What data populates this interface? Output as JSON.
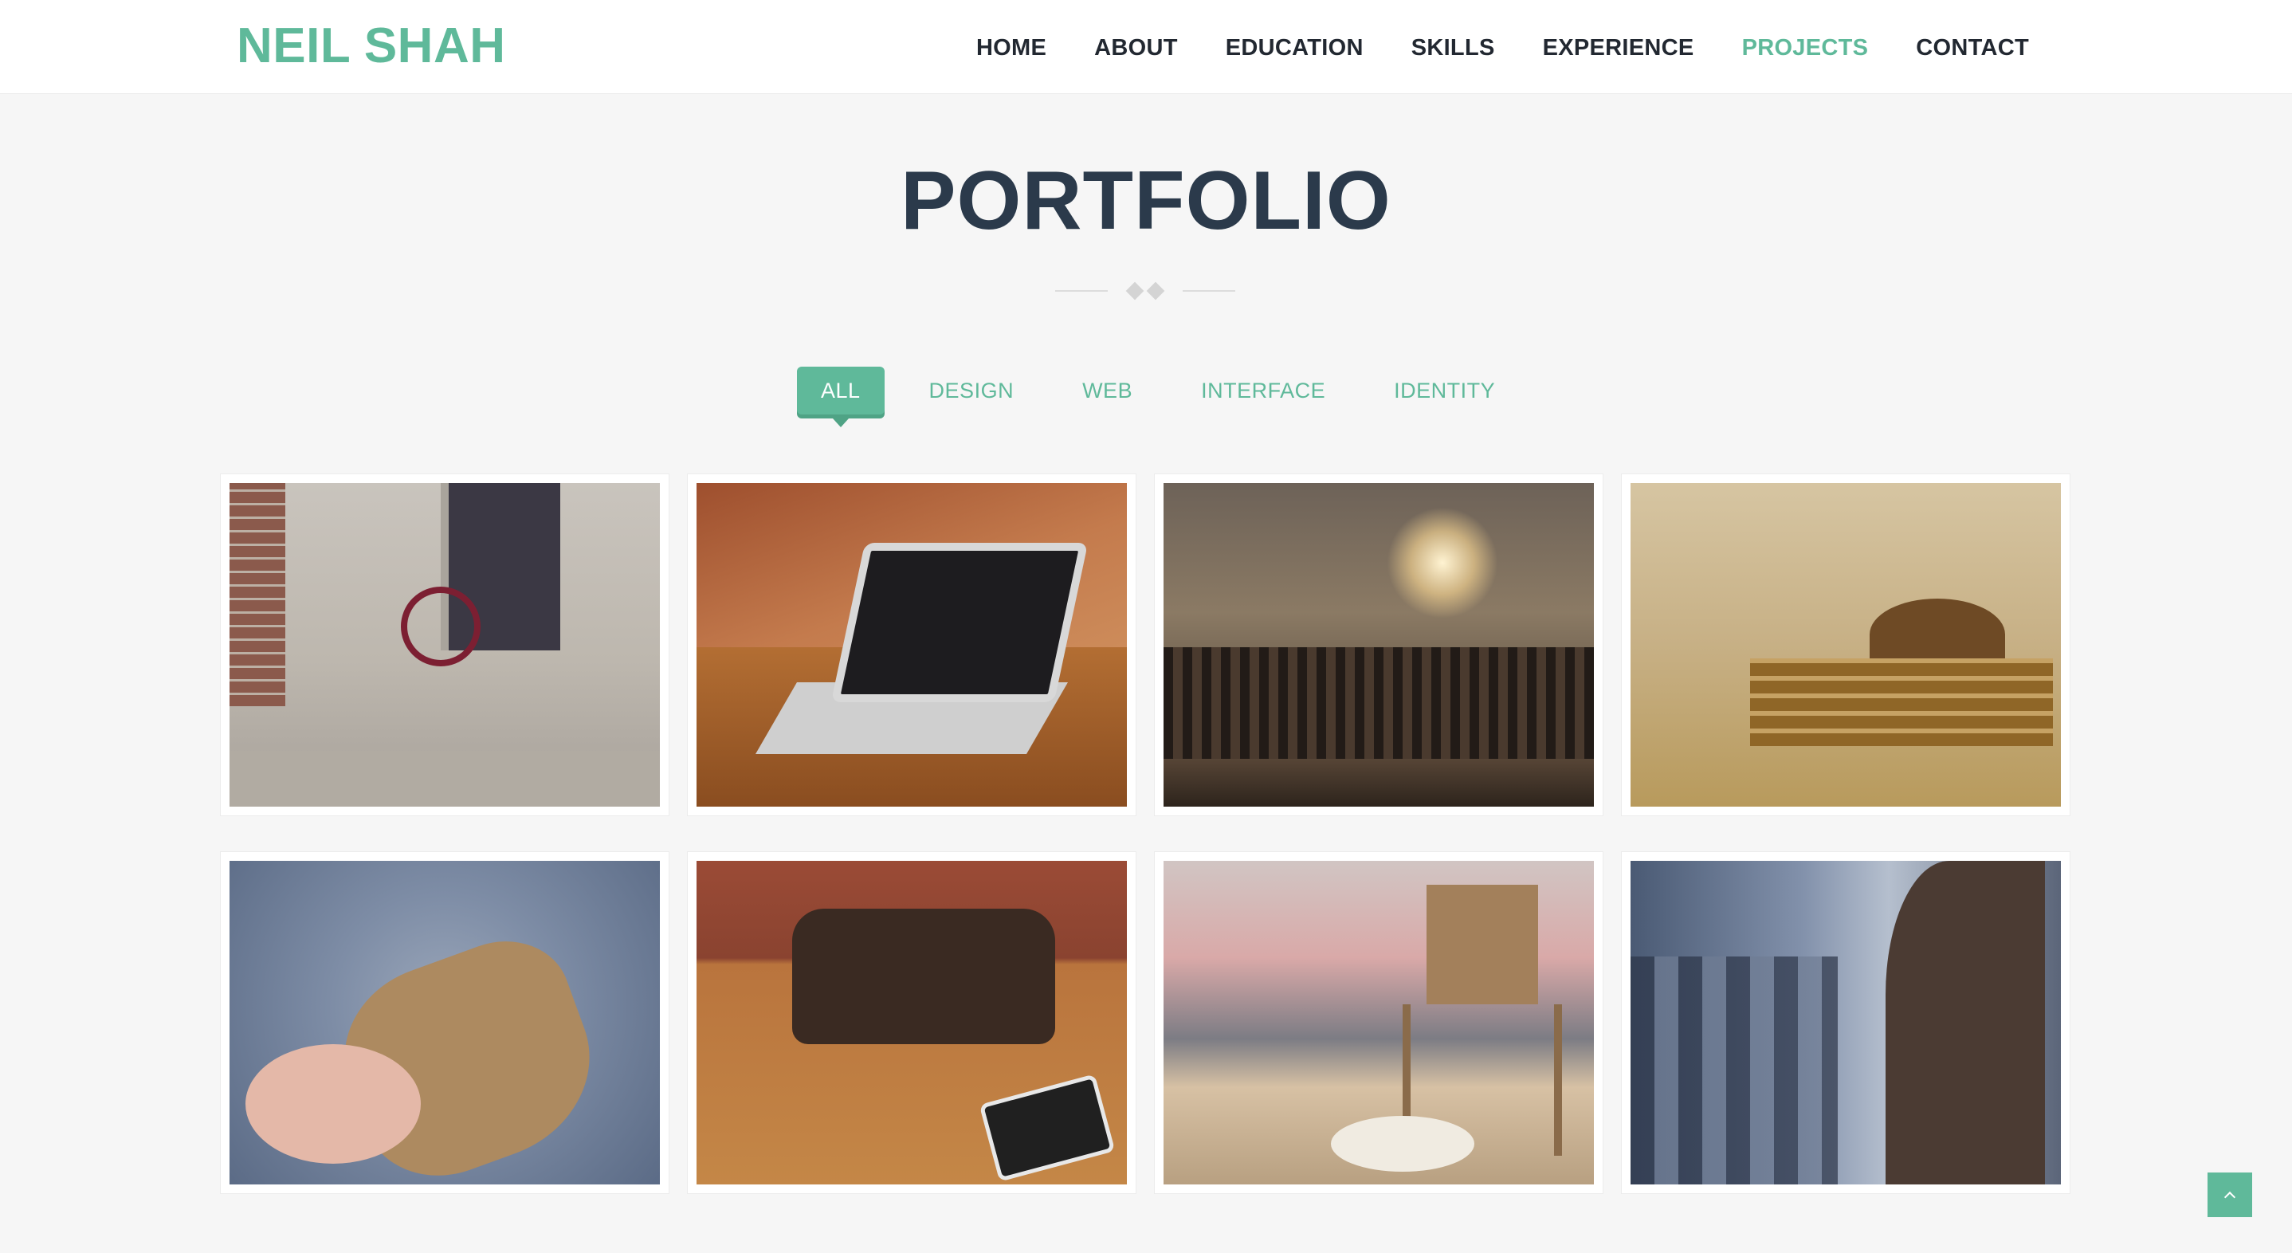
{
  "header": {
    "logo": "NEIL SHAH",
    "nav": [
      {
        "label": "HOME",
        "active": false
      },
      {
        "label": "ABOUT",
        "active": false
      },
      {
        "label": "EDUCATION",
        "active": false
      },
      {
        "label": "SKILLS",
        "active": false
      },
      {
        "label": "EXPERIENCE",
        "active": false
      },
      {
        "label": "PROJECTS",
        "active": true
      },
      {
        "label": "CONTACT",
        "active": false
      }
    ]
  },
  "portfolio": {
    "title": "PORTFOLIO",
    "filters": [
      {
        "label": "ALL",
        "active": true
      },
      {
        "label": "DESIGN",
        "active": false
      },
      {
        "label": "WEB",
        "active": false
      },
      {
        "label": "INTERFACE",
        "active": false
      },
      {
        "label": "IDENTITY",
        "active": false
      }
    ],
    "items": [
      {
        "name": "tricycle-photo"
      },
      {
        "name": "laptop-photo"
      },
      {
        "name": "city-street-photo"
      },
      {
        "name": "bench-couple-photo"
      },
      {
        "name": "sandwich-photo"
      },
      {
        "name": "desk-meeting-photo"
      },
      {
        "name": "lifeguard-tower-photo"
      },
      {
        "name": "airplane-passenger-photo"
      }
    ]
  },
  "icons": {
    "back_to_top": "chevron-up-icon"
  },
  "colors": {
    "accent": "#5fb99a",
    "title": "#2b3a4b",
    "nav_text": "#222831",
    "background": "#f6f6f6"
  }
}
